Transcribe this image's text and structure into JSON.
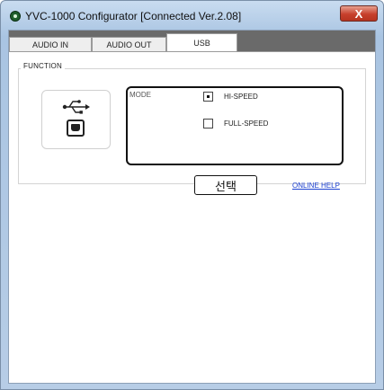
{
  "window": {
    "title": "YVC-1000 Configurator   [Connected  Ver.2.08]",
    "close_label": "X"
  },
  "tabs": [
    {
      "label": "AUDIO IN",
      "active": false
    },
    {
      "label": "AUDIO OUT",
      "active": false
    },
    {
      "label": "USB",
      "active": true
    }
  ],
  "function_group": {
    "label": "FUNCTION",
    "icons": [
      "usb-symbol-icon",
      "usb-b-connector-icon"
    ],
    "mode": {
      "label": "MODE",
      "options": [
        {
          "label": "HI-SPEED",
          "selected": true
        },
        {
          "label": "FULL-SPEED",
          "selected": false
        }
      ]
    }
  },
  "callout": {
    "label": "선택"
  },
  "help": {
    "label": "ONLINE HELP"
  }
}
